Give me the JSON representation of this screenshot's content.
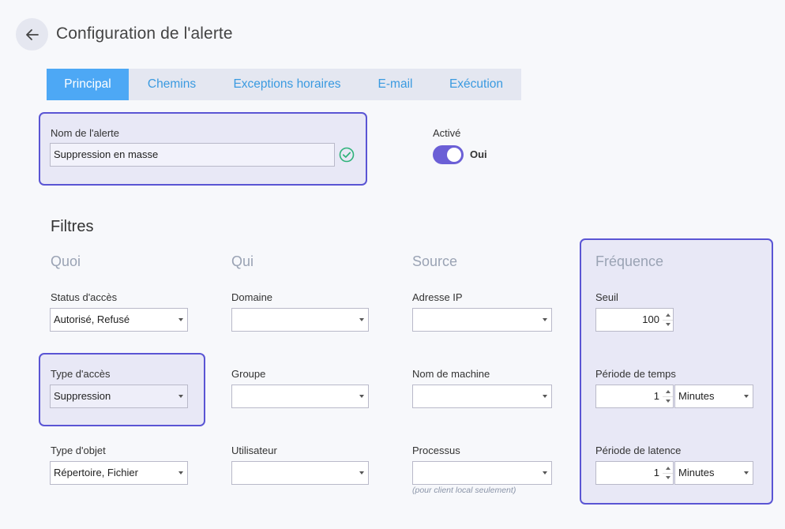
{
  "header": {
    "title": "Configuration de l'alerte"
  },
  "tabs": [
    {
      "label": "Principal",
      "active": true
    },
    {
      "label": "Chemins"
    },
    {
      "label": "Exceptions horaires"
    },
    {
      "label": "E-mail"
    },
    {
      "label": "Exécution"
    }
  ],
  "alert_name": {
    "label": "Nom de l'alerte",
    "value": "Suppression en masse"
  },
  "enabled": {
    "label": "Activé",
    "value": "Oui",
    "on": true
  },
  "filters": {
    "title": "Filtres",
    "what": {
      "heading": "Quoi",
      "access_status": {
        "label": "Status d'accès",
        "value": "Autorisé, Refusé"
      },
      "access_type": {
        "label": "Type d'accès",
        "value": "Suppression"
      },
      "object_type": {
        "label": "Type d'objet",
        "value": "Répertoire, Fichier"
      }
    },
    "who": {
      "heading": "Qui",
      "domain": {
        "label": "Domaine",
        "value": ""
      },
      "group": {
        "label": "Groupe",
        "value": ""
      },
      "user": {
        "label": "Utilisateur",
        "value": ""
      }
    },
    "source": {
      "heading": "Source",
      "ip": {
        "label": "Adresse IP",
        "value": ""
      },
      "machine": {
        "label": "Nom de machine",
        "value": ""
      },
      "process": {
        "label": "Processus",
        "value": "",
        "note": "(pour client local seulement)"
      }
    },
    "frequency": {
      "heading": "Fréquence",
      "threshold": {
        "label": "Seuil",
        "value": "100"
      },
      "time_period": {
        "label": "Période de temps",
        "value": "1",
        "unit": "Minutes"
      },
      "latency_period": {
        "label": "Période de latence",
        "value": "1",
        "unit": "Minutes"
      }
    }
  },
  "colors": {
    "accent": "#4da8f5",
    "highlight_border": "#5a55d4",
    "toggle": "#6b5fd6",
    "valid": "#2fb37a"
  }
}
